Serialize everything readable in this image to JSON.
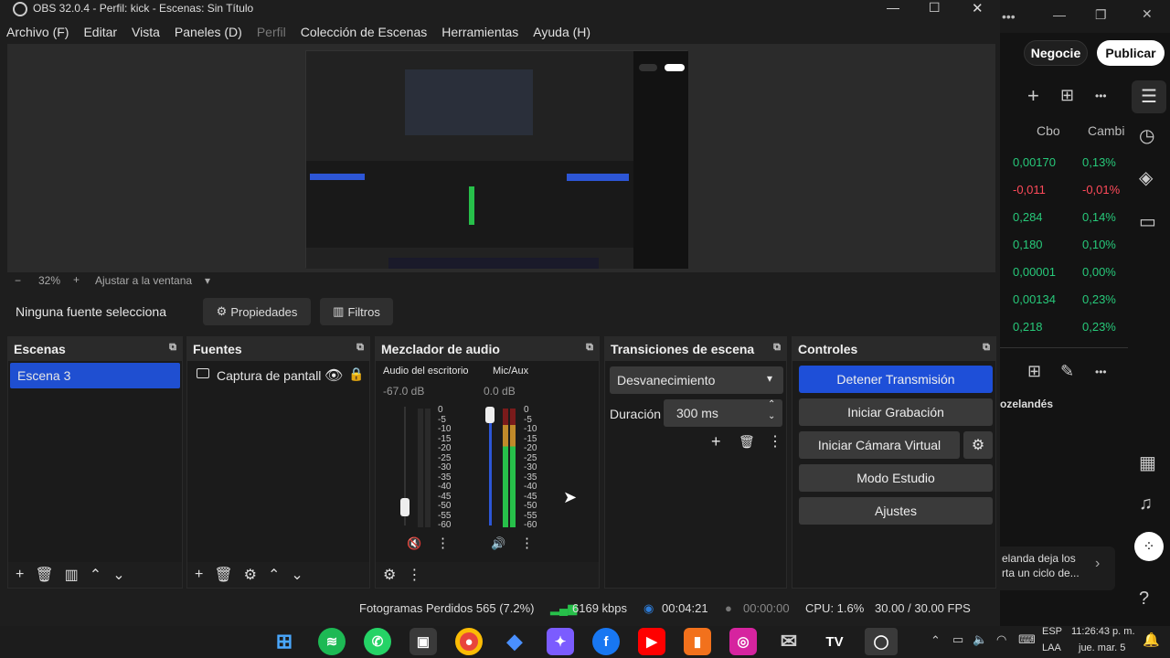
{
  "window": {
    "title": "OBS 32.0.4 - Perfil: kick - Escenas: Sin Título"
  },
  "menu": [
    "Archivo (F)",
    "Editar",
    "Vista",
    "Paneles (D)",
    "Perfil",
    "Colección de Escenas",
    "Herramientas",
    "Ayuda (H)"
  ],
  "preview": {
    "zoom": "32%",
    "fit_label": "Ajustar a la ventana"
  },
  "source_toolbar": {
    "no_source": "Ninguna fuente selecciona",
    "properties": "Propiedades",
    "filters": "Filtros"
  },
  "scenes": {
    "title": "Escenas",
    "items": [
      "Escena 3"
    ]
  },
  "sources": {
    "title": "Fuentes",
    "items": [
      "Captura de pantall"
    ]
  },
  "mixer": {
    "title": "Mezclador de audio",
    "channels": [
      {
        "name": "Audio del escritorio",
        "db": "-67.0 dB"
      },
      {
        "name": "Mic/Aux",
        "db": "0.0 dB"
      }
    ],
    "scale": [
      "0",
      "-5",
      "-10",
      "-15",
      "-20",
      "-25",
      "-30",
      "-35",
      "-40",
      "-45",
      "-50",
      "-55",
      "-60"
    ]
  },
  "transitions": {
    "title": "Transiciones de escena",
    "selected": "Desvanecimiento",
    "duration_label": "Duración",
    "duration_value": "300 ms"
  },
  "controls": {
    "title": "Controles",
    "buttons": [
      "Detener Transmisión",
      "Iniciar Grabación",
      "Iniciar Cámara Virtual",
      "Modo Estudio",
      "Ajustes"
    ]
  },
  "status": {
    "dropped": "Fotogramas Perdidos 565 (7.2%)",
    "bitrate": "6169 kbps",
    "stream_time": "00:04:21",
    "rec_time": "00:00:00",
    "cpu": "CPU: 1.6%",
    "fps": "30.00 / 30.00 FPS"
  },
  "bgapp": {
    "negotiate": "Negocie",
    "publish": "Publicar",
    "col_cbo": "Cbo",
    "col_cambi": "Cambi",
    "rows": [
      {
        "cbo": "0,00170",
        "cambi": "0,13%",
        "dir": "pos"
      },
      {
        "cbo": "-0,011",
        "cambi": "-0,01%",
        "dir": "neg"
      },
      {
        "cbo": "0,284",
        "cambi": "0,14%",
        "dir": "pos"
      },
      {
        "cbo": "0,180",
        "cambi": "0,10%",
        "dir": "pos"
      },
      {
        "cbo": "0,00001",
        "cambi": "0,00%",
        "dir": "pos"
      },
      {
        "cbo": "0,00134",
        "cambi": "0,23%",
        "dir": "pos"
      },
      {
        "cbo": "0,218",
        "cambi": "0,23%",
        "dir": "pos"
      }
    ],
    "news_tag": "ozelandés",
    "news_line1": "elanda deja los",
    "news_line2": "rta un ciclo de..."
  },
  "taskbar": {
    "lang1": "ESP",
    "lang2": "LAA",
    "time": "11:26:43 p. m.",
    "date": "jue. mar. 5"
  },
  "colors": {
    "accent": "#1e4fd8",
    "scene_selected": "#1f4fd1",
    "meter_green": "#27c04a"
  }
}
